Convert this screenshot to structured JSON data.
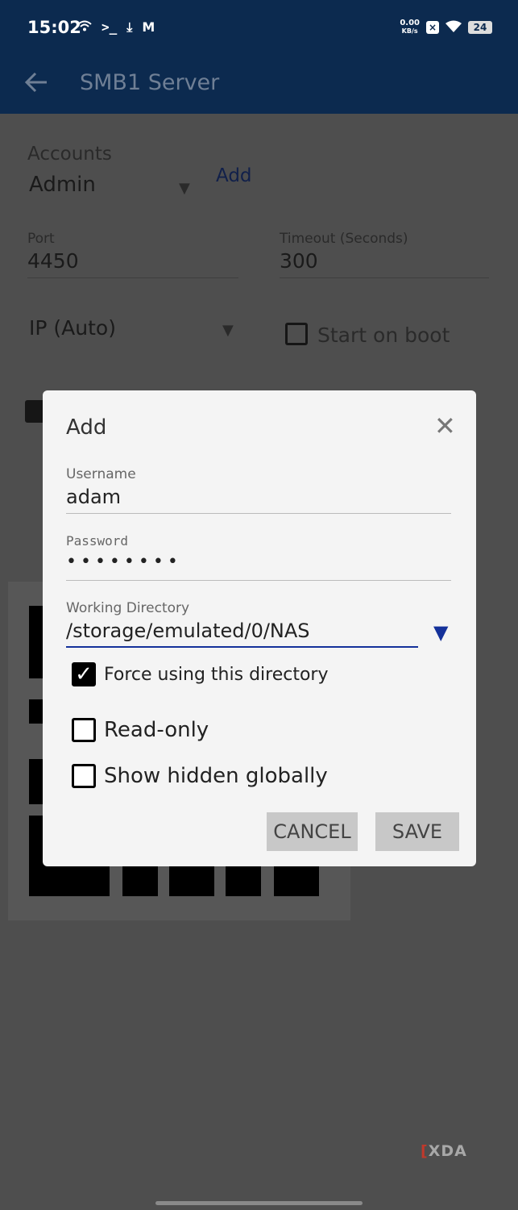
{
  "status_bar": {
    "time": "15:02",
    "left_icons": [
      "wifi-icon",
      "terminal-icon",
      "download-icon",
      "gmail-icon"
    ],
    "net_speed_value": "0.00",
    "net_speed_unit": "KB/s",
    "battery": "24"
  },
  "app_bar": {
    "title": "SMB1 Server"
  },
  "background": {
    "accounts_label": "Accounts",
    "account_selected": "Admin",
    "add_link": "Add",
    "port_label": "Port",
    "port_value": "4450",
    "timeout_label": "Timeout (Seconds)",
    "timeout_value": "300",
    "ip_selected": "IP (Auto)",
    "start_on_boot": "Start on boot"
  },
  "dialog": {
    "title": "Add",
    "username_label": "Username",
    "username_value": "adam",
    "password_label": "Password",
    "password_value": "••••••••",
    "working_directory_label": "Working Directory",
    "working_directory_value": "/storage/emulated/0/NAS",
    "options": [
      {
        "label": "Force using this directory",
        "checked": true
      },
      {
        "label": "Read-only",
        "checked": false
      },
      {
        "label": "Show hidden globally",
        "checked": false
      }
    ],
    "cancel_label": "CANCEL",
    "save_label": "SAVE"
  },
  "watermark": {
    "logo_text": "XDA"
  },
  "colors": {
    "app_bar": "#0c2a4f",
    "dialog_bg": "#f4f4f4",
    "accent": "#14319a",
    "scrim": "#4e4e4e"
  }
}
